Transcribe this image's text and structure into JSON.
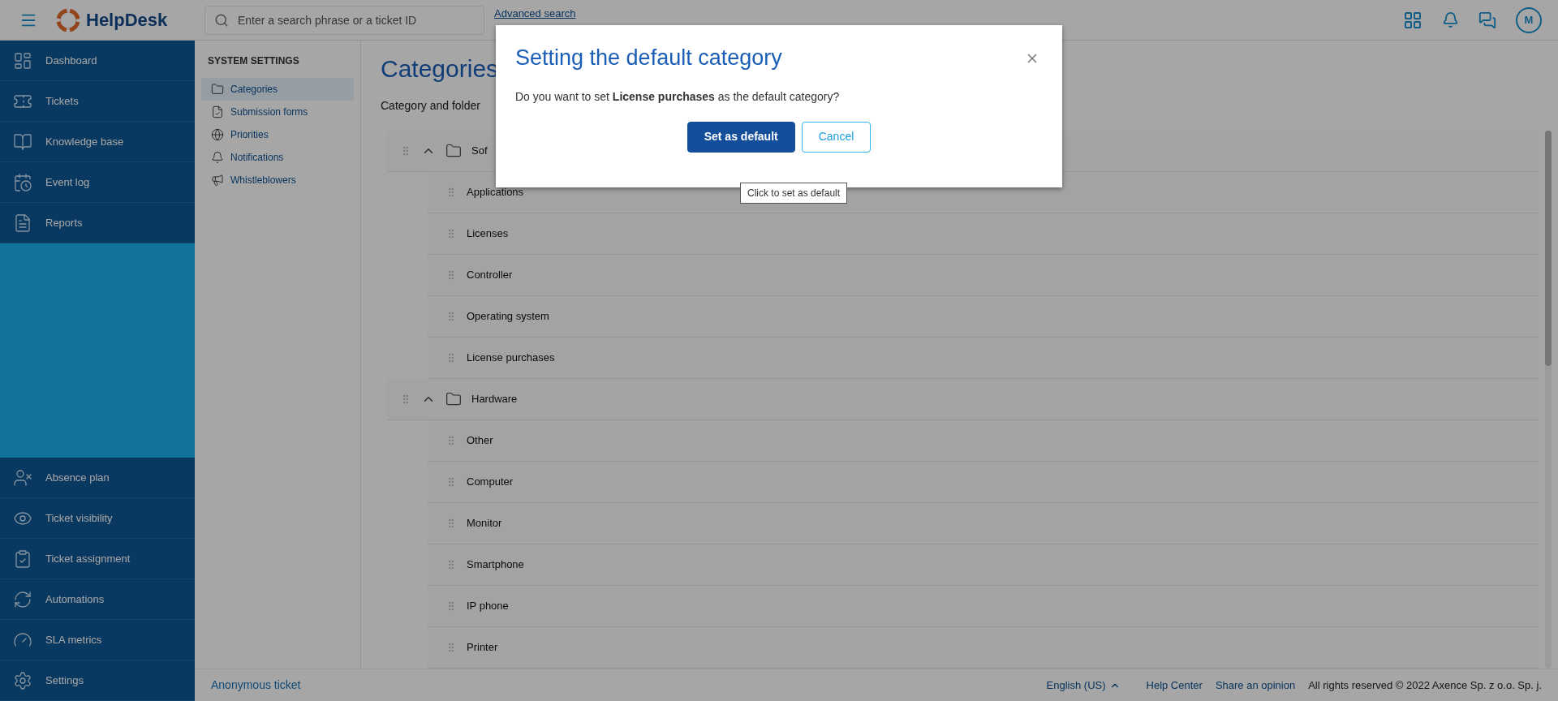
{
  "header": {
    "logo": "HelpDesk",
    "search": {
      "placeholder": "Enter a search phrase or a ticket ID"
    },
    "advanced_search": "Advanced search",
    "avatar": "M"
  },
  "sidebar": {
    "top_items": [
      {
        "label": "Dashboard"
      },
      {
        "label": "Tickets"
      },
      {
        "label": "Knowledge base"
      },
      {
        "label": "Event log"
      },
      {
        "label": "Reports"
      }
    ],
    "bottom_items": [
      {
        "label": "Absence plan"
      },
      {
        "label": "Ticket visibility"
      },
      {
        "label": "Ticket assignment"
      },
      {
        "label": "Automations"
      },
      {
        "label": "SLA metrics"
      },
      {
        "label": "Settings"
      }
    ]
  },
  "settings_nav": {
    "heading": "SYSTEM SETTINGS",
    "items": [
      {
        "label": "Categories",
        "selected": true
      },
      {
        "label": "Submission forms",
        "selected": false
      },
      {
        "label": "Priorities",
        "selected": false
      },
      {
        "label": "Notifications",
        "selected": false
      },
      {
        "label": "Whistleblowers",
        "selected": false
      }
    ]
  },
  "content": {
    "title": "Categories",
    "subtitle": "Category and folder",
    "tree": [
      {
        "label": "Sof",
        "expanded": true,
        "children": [
          {
            "label": "Applications"
          },
          {
            "label": "Licenses"
          },
          {
            "label": "Controller"
          },
          {
            "label": "Operating system"
          },
          {
            "label": "License purchases"
          }
        ]
      },
      {
        "label": "Hardware",
        "expanded": true,
        "children": [
          {
            "label": "Other"
          },
          {
            "label": "Computer"
          },
          {
            "label": "Monitor"
          },
          {
            "label": "Smartphone"
          },
          {
            "label": "IP phone"
          },
          {
            "label": "Printer"
          }
        ]
      }
    ]
  },
  "footer": {
    "anonymous_ticket": "Anonymous ticket",
    "language": "English (US)",
    "links": [
      "Help Center",
      "Share an opinion"
    ],
    "copyright": "All rights reserved © 2022 Axence Sp. z o.o. Sp. j."
  },
  "dialog": {
    "title": "Setting the default category",
    "message": "Do you want to set **License purchases** as the default category?",
    "buttons": [
      {
        "label": "Set as default",
        "kind": "primary"
      },
      {
        "label": "Cancel",
        "kind": "secondary"
      }
    ],
    "tooltip": "Click to set as default"
  }
}
